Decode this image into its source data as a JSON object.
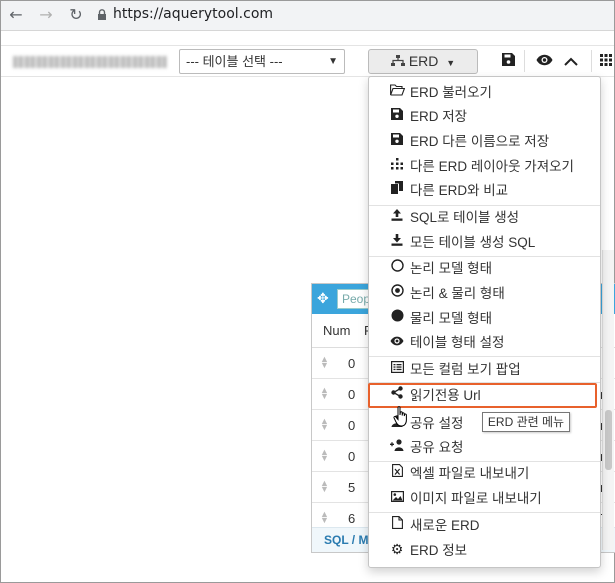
{
  "browser": {
    "url": "https://aquerytool.com",
    "back_icon": "arrow-left-icon",
    "forward_icon": "arrow-right-icon",
    "reload_icon": "reload-icon"
  },
  "toolbar": {
    "table_select_value": "--- 테이블 선택 ---",
    "erd_button_label": "ERD"
  },
  "menu": {
    "items": [
      {
        "icon": "folder-open-icon",
        "label": "ERD 불러오기"
      },
      {
        "icon": "save-icon",
        "label": "ERD 저장"
      },
      {
        "icon": "save-icon",
        "label": "ERD 다른 이름으로 저장"
      },
      {
        "icon": "layout-icon",
        "label": "다른 ERD 레이아웃 가져오기"
      },
      {
        "icon": "copy-icon",
        "label": "다른 ERD와 비교"
      },
      {
        "icon": "upload-icon",
        "label": "SQL로 테이블 생성"
      },
      {
        "icon": "download-icon",
        "label": "모든 테이블 생성 SQL"
      },
      {
        "icon": "circle-empty-icon",
        "label": "논리 모델 형태"
      },
      {
        "icon": "circle-dot-icon",
        "label": "논리 & 물리 형태"
      },
      {
        "icon": "circle-filled-icon",
        "label": "물리 모델 형태"
      },
      {
        "icon": "eye-icon",
        "label": "테이블 형태 설정"
      },
      {
        "icon": "list-icon",
        "label": "모든 컬럼 보기 팝업"
      },
      {
        "icon": "share-icon",
        "label": "읽기전용 Url"
      },
      {
        "icon": "user-icon",
        "label": "공유 설정"
      },
      {
        "icon": "user-plus-icon",
        "label": "공유 요청"
      },
      {
        "icon": "excel-file-icon",
        "label": "엑셀 파일로 내보내기"
      },
      {
        "icon": "image-icon",
        "label": "이미지 파일로 내보내기"
      },
      {
        "icon": "file-icon",
        "label": "새로운 ERD"
      },
      {
        "icon": "gear-icon",
        "label": "ERD 정보"
      }
    ]
  },
  "tooltip": "ERD 관련 메뉴",
  "entity": {
    "name_placeholder": "Peop",
    "col_num": "Num",
    "col_second": "F",
    "rows": [
      {
        "num": "0",
        "right": ""
      },
      {
        "num": "0",
        "right": "rc"
      },
      {
        "num": "0",
        "right": "rc"
      },
      {
        "num": "0",
        "right": "rc"
      },
      {
        "num": "5",
        "right": "rc"
      },
      {
        "num": "6",
        "right": "T"
      }
    ],
    "footer": "SQL / Me"
  }
}
